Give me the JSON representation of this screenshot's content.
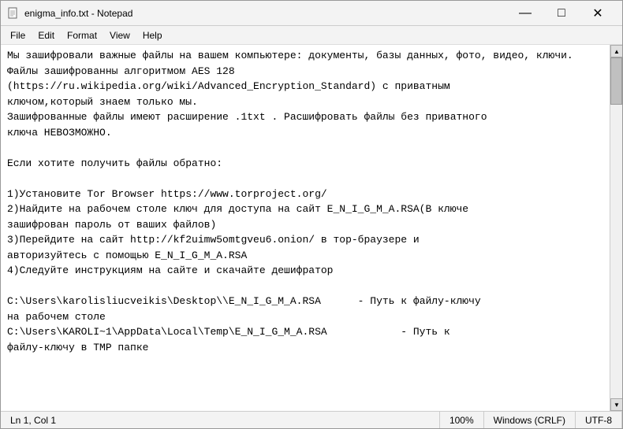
{
  "window": {
    "title": "enigma_info.txt - Notepad",
    "icon": "📄"
  },
  "menu": {
    "items": [
      "File",
      "Edit",
      "Format",
      "View",
      "Help"
    ]
  },
  "content": {
    "text": "Мы зашифровали важные файлы на вашем компьютере: документы, базы данных, фото, видео, ключи.\nФайлы зашифрованны алгоритмом AES 128\n(https://ru.wikipedia.org/wiki/Advanced_Encryption_Standard) с приватным\nключом,который знаем только мы.\nЗашифрованные файлы имеют расширение .1txt . Расшифровать файлы без приватного\nключа НЕВОЗМОЖНО.\n\nЕсли хотите получить файлы обратно:\n\n1)Установите Tor Browser https://www.torproject.org/\n2)Найдите на рабочем столе ключ для доступа на сайт E_N_I_G_M_A.RSA(В ключе\nзашифрован пароль от ваших файлов)\n3)Перейдите на сайт http://kf2uimw5omtgveu6.onion/ в тор-браузере и\nавторизуйтесь с помощью E_N_I_G_M_A.RSA\n4)Следуйте инструкциям на сайте и скачайте дешифратор\n\nC:\\Users\\karolisliucveikis\\Desktop\\\\E_N_I_G_M_A.RSA\t - Путь к файлу-ключу\nна рабочем столе\nC:\\Users\\KAROLI~1\\AppData\\Local\\Temp\\E_N_I_G_M_A.RSA\t\t- Путь к\nфайлу-ключу в TMP папке"
  },
  "statusbar": {
    "position": "Ln 1, Col 1",
    "zoom": "100%",
    "line_ending": "Windows (CRLF)",
    "encoding": "UTF-8"
  },
  "controls": {
    "minimize": "—",
    "maximize": "□",
    "close": "✕"
  }
}
